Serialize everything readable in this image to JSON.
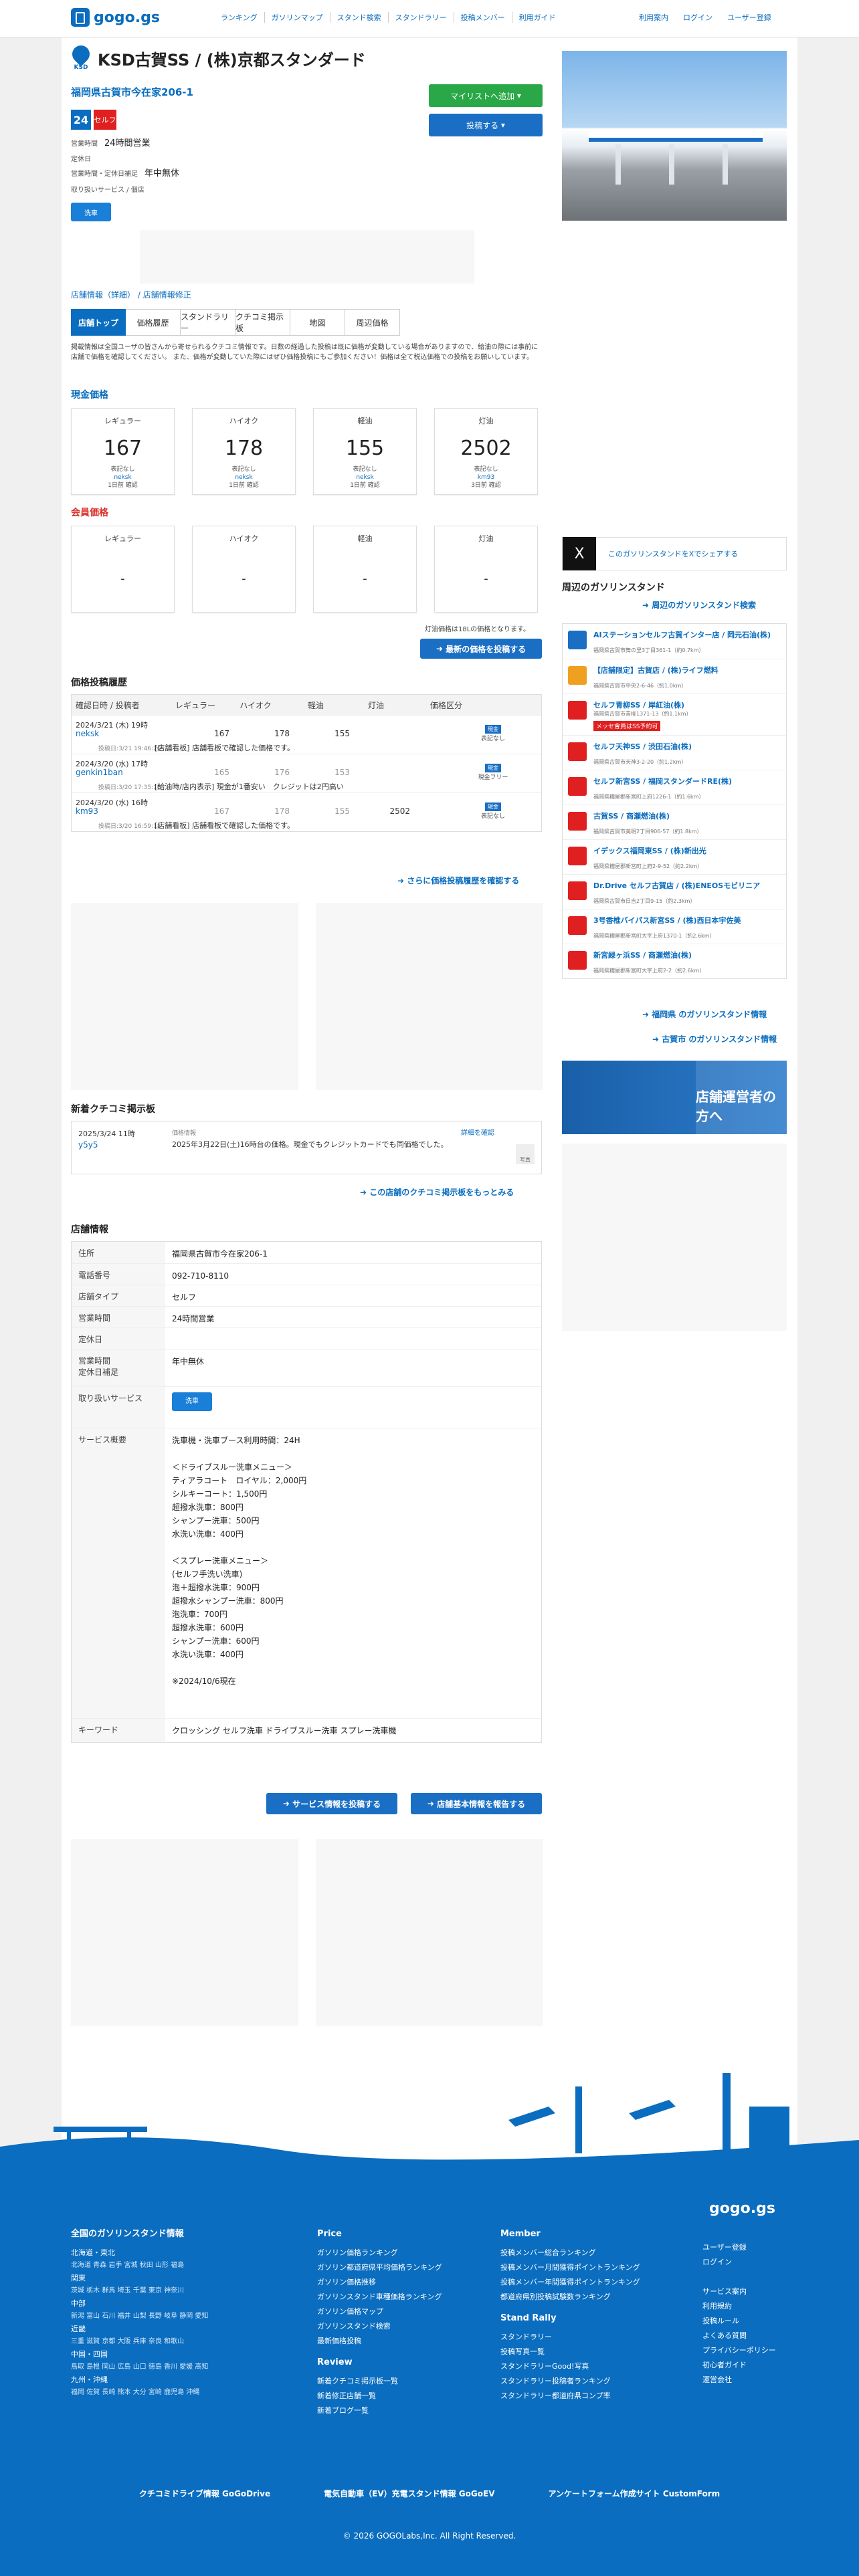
{
  "header": {
    "logo": "gogo.gs",
    "nav": [
      "ランキング",
      "ガソリンマップ",
      "スタンド検索",
      "スタンドラリー",
      "投稿メンバー",
      "利用ガイド"
    ],
    "right": [
      "利用案内",
      "ログイン",
      "ユーザー登録"
    ]
  },
  "station": {
    "brand_mark": "KSD",
    "title": "KSD古賀SS / (株)京都スタンダード",
    "address": "福岡県古賀市今在家206-1",
    "badge_24": "24",
    "badge_self": "セルフ",
    "hours_label": "営業時間",
    "hours_value": "24時間営業",
    "closed_label": "定休日",
    "closed2_label": "営業時間・定休日補足",
    "closed2_value": "年中無休",
    "services_label": "取り扱いサービス / 個店",
    "service_icon": "洗車"
  },
  "actions": {
    "mylist": "マイリストへ追加",
    "post": "投稿する"
  },
  "crumbs": {
    "a": "店舗情報（詳細）",
    "b": "店舗情報修正"
  },
  "tabs": [
    "店舗トップ",
    "価格履歴",
    "スタンドラリー",
    "クチコミ掲示板",
    "地図",
    "周辺価格"
  ],
  "notice": "掲載情報は全国ユーザの皆さんから寄せられるクチコミ情報です。日数の経過した投稿は既に価格が変動している場合がありますので、給油の際には事前に店舗で価格を確認してください。 また、価格が変動していた際にはぜひ価格投稿にもご参加ください！価格は全て税込価格での投稿をお願いしています。",
  "cash": {
    "heading": "現金価格",
    "cards": [
      {
        "label": "レギュラー",
        "price": "167",
        "note": "表記なし",
        "user": "neksk",
        "when": "1日前 確認"
      },
      {
        "label": "ハイオク",
        "price": "178",
        "note": "表記なし",
        "user": "neksk",
        "when": "1日前 確認"
      },
      {
        "label": "軽油",
        "price": "155",
        "note": "表記なし",
        "user": "neksk",
        "when": "1日前 確認"
      },
      {
        "label": "灯油",
        "price": "2502",
        "note": "表記なし",
        "user": "km93",
        "when": "3日前 確認"
      }
    ]
  },
  "member": {
    "heading": "会員価格",
    "cards": [
      {
        "label": "レギュラー",
        "price": "-"
      },
      {
        "label": "ハイオク",
        "price": "-"
      },
      {
        "label": "軽油",
        "price": "-"
      },
      {
        "label": "灯油",
        "price": "-"
      }
    ]
  },
  "kerosene_note": "灯油価格は18Lの価格となります。",
  "latest_post": "最新の価格を投稿する",
  "history": {
    "title": "価格投稿履歴",
    "columns": [
      "確認日時 / 投稿者",
      "レギュラー",
      "ハイオク",
      "軽油",
      "灯油",
      "価格区分"
    ],
    "rows": [
      {
        "date": "2024/3/21 (木) 19時",
        "user": "neksk",
        "posted": "投稿日:3/21 19:46:20",
        "reg": "167",
        "hi": "178",
        "diesel": "155",
        "kero": "",
        "tag": "現金",
        "cls": "表記なし",
        "comment": "[店舗看板] 店舗看板で確認した価格です。"
      },
      {
        "date": "2024/3/20 (水) 17時",
        "user": "genkin1ban",
        "posted": "投稿日:3/20 17:35:10",
        "reg": "165",
        "hi": "176",
        "diesel": "153",
        "kero": "",
        "tag": "現金",
        "cls": "現金フリー",
        "comment": "[給油時/店内表示] 現金が1番安い　クレジットは2円高い"
      },
      {
        "date": "2024/3/20 (水) 16時",
        "user": "km93",
        "posted": "投稿日:3/20 16:59:18",
        "reg": "167",
        "hi": "178",
        "diesel": "155",
        "kero": "2502",
        "tag": "現金",
        "cls": "表記なし",
        "comment": "[店舗看板] 店舗看板で確認した価格です。"
      }
    ],
    "more": "さらに価格投稿履歴を確認する"
  },
  "board": {
    "title": "新着クチコミ掲示板",
    "date": "2025/3/24 11時",
    "user": "y5y5",
    "category": "価格情報",
    "text": "2025年3月22日(土)16時台の価格。現金でもクレジットカードでも同価格でした。",
    "detail": "詳細を確認",
    "badge": "写真",
    "more": "この店舗のクチコミ掲示板をもっとみる"
  },
  "shop": {
    "title": "店舗情報",
    "rows": [
      {
        "k": "住所",
        "v": "福岡県古賀市今在家206-1"
      },
      {
        "k": "電話番号",
        "v": "092-710-8110"
      },
      {
        "k": "店舗タイプ",
        "v": "セルフ"
      },
      {
        "k": "営業時間",
        "v": "24時間営業"
      },
      {
        "k": "定休日",
        "v": ""
      },
      {
        "k": "営業時間\n定休日補足",
        "v": "年中無休"
      },
      {
        "k": "取り扱いサービス",
        "v": ""
      },
      {
        "k": "サービス概要",
        "v": "洗車機・洗車ブース利用時間：24H\n\n＜ドライブスルー洗車メニュー＞\nティアラコート　ロイヤル：2,000円\nシルキーコート：1,500円\n超撥水洗車：800円\nシャンプー洗車：500円\n水洗い洗車：400円\n\n＜スプレー洗車メニュー＞\n(セルフ手洗い洗車)\n泡＋超撥水洗車：900円\n超撥水シャンプー洗車：800円\n泡洗車：700円\n超撥水洗車：600円\nシャンプー洗車：600円\n水洗い洗車：400円\n\n※2024/10/6現在"
      },
      {
        "k": "キーワード",
        "v": "クロッシング セルフ洗車 ドライブスルー洗車 スプレー洗車機"
      }
    ],
    "btn_service": "サービス情報を投稿する",
    "btn_basic": "店舗基本情報を報告する"
  },
  "side": {
    "x_text": "このガソリンスタンドをXでシェアする",
    "x_glyph": "X",
    "nearby_title": "周辺のガソリンスタンド",
    "nearby_link": "周辺のガソリンスタンド検索",
    "items": [
      {
        "name": "AIステーションセルフ古賀インター店 / 岡元石油(株)",
        "addr": "福岡県古賀市舞の里3丁目361-1（約0.7km）",
        "color": "#1a6fc4",
        "tag": ""
      },
      {
        "name": "【店舗限定】古賀店 / (株)ライフ燃料",
        "addr": "福岡県古賀市中央2-6-46（約1.0km）",
        "color": "#f0a020",
        "tag": ""
      },
      {
        "name": "セルフ青柳SS / 岸紅油(株)",
        "addr": "福岡県古賀市青柳1371-13（約1.1km）",
        "color": "#e02020",
        "tag": "メッセ會員はSS予約可"
      },
      {
        "name": "セルフ天神SS / 渋田石油(株)",
        "addr": "福岡県古賀市天神3-2-20（約1.2km）",
        "color": "#e02020",
        "tag": ""
      },
      {
        "name": "セルフ新宮SS / 福岡スタンダードRE(株)",
        "addr": "福岡県糟屋郡新宮町上府1226-1（約1.6km）",
        "color": "#e02020",
        "tag": ""
      },
      {
        "name": "古賀SS / 商瀬燃油(株)",
        "addr": "福岡県古賀市美明2丁目906-57（約1.8km）",
        "color": "#e02020",
        "tag": ""
      },
      {
        "name": "イデックス福岡東SS / (株)新出光",
        "addr": "福岡県糟屋郡新宮町上府2-9-52（約2.2km）",
        "color": "#e02020",
        "tag": ""
      },
      {
        "name": "Dr.Drive セルフ古賀店 / (株)ENEOSモビリニア",
        "addr": "福岡県古賀市日吉2丁目9-15（約2.3km）",
        "color": "#e02020",
        "tag": ""
      },
      {
        "name": "3号香椎バイパス新宮SS / (株)西日本宇佐美",
        "addr": "福岡県糟屋郡新宮町大字上府1370-1（約2.6km）",
        "color": "#e02020",
        "tag": ""
      },
      {
        "name": "新宮緑ヶ浜SS / 商瀬燃油(株)",
        "addr": "福岡県糟屋郡新宮町大字上府2-2（約2.6km）",
        "color": "#e02020",
        "tag": ""
      }
    ],
    "link1": "福岡県 のガソリンスタンド情報",
    "link2": "古賀市 のガソリンスタンド情報",
    "banner": "店舗運営者の方へ"
  },
  "footer": {
    "logo": "gogo.gs",
    "col1_title": "全国のガソリンスタンド情報",
    "regions": [
      {
        "name": "北海道・東北",
        "prefs": "北海道 青森 岩手 宮城 秋田 山形 福島"
      },
      {
        "name": "関東",
        "prefs": "茨城 栃木 群馬 埼玉 千葉 東京 神奈川"
      },
      {
        "name": "中部",
        "prefs": "新潟 富山 石川 福井 山梨 長野 岐阜 静岡 愛知"
      },
      {
        "name": "近畿",
        "prefs": "三重 滋賀 京都 大阪 兵庫 奈良 和歌山"
      },
      {
        "name": "中国・四国",
        "prefs": "鳥取 島根 岡山 広島 山口 徳島 香川 愛媛 高知"
      },
      {
        "name": "九州・沖縄",
        "prefs": "福岡 佐賀 長崎 熊本 大分 宮崎 鹿児島 沖縄"
      }
    ],
    "price_title": "Price",
    "price_links": [
      "ガソリン価格ランキング",
      "ガソリン都道府県平均価格ランキング",
      "ガソリン価格推移",
      "ガソリンスタンド車種価格ランキング",
      "ガソリン価格マップ",
      "ガソリンスタンド検索",
      "最新価格投稿"
    ],
    "review_title": "Review",
    "review_links": [
      "新着クチコミ掲示板一覧",
      "新着修正店舗一覧",
      "新着ブログ一覧"
    ],
    "member_title": "Member",
    "member_links": [
      "投稿メンバー総合ランキング",
      "投稿メンバー月間獲得ポイントランキング",
      "投稿メンバー年間獲得ポイントランキング",
      "都道府県別投稿試験数ランキング"
    ],
    "rally_title": "Stand Rally",
    "rally_links": [
      "スタンドラリー",
      "投稿写真一覧",
      "スタンドラリーGood!写真",
      "スタンドラリー投稿者ランキング",
      "スタンドラリー都道府県コンプ率"
    ],
    "col4": [
      "ユーザー登録",
      "ログイン",
      "",
      "サービス案内",
      "利用規約",
      "投稿ルール",
      "よくある質問",
      "プライバシーポリシー",
      "初心者ガイド",
      "運営会社"
    ],
    "bottom": [
      "クチコミドライブ情報 GoGoDrive",
      "電気自動車（EV）充電スタンド情報 GoGoEV",
      "アンケートフォーム作成サイト CustomForm"
    ],
    "copyright": "© 2026 GOGOLabs,Inc. All Right Reserved."
  }
}
